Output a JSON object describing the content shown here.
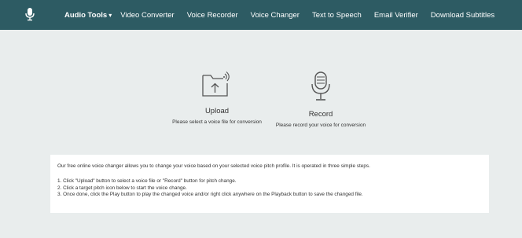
{
  "nav": {
    "logo_icon": "microphone-icon",
    "items": [
      "Audio Tools",
      "Video Converter",
      "Voice Recorder",
      "Voice Changer",
      "Text to Speech",
      "Email Verifier",
      "Download Subtitles"
    ],
    "dropdown_icon": "caret-down-icon"
  },
  "actions": {
    "upload": {
      "title": "Upload",
      "subtitle": "Please select a voice file for conversion",
      "icon": "upload-folder-icon"
    },
    "record": {
      "title": "Record",
      "subtitle": "Please record your voice for conversion",
      "icon": "microphone-icon"
    }
  },
  "info": {
    "intro": "Our free online voice changer allows you to change your voice based on your selected voice pitch profile. It is operated in three simple steps.",
    "steps": [
      "1. Click \"Upload\" button to select a voice file or \"Record\" button for pitch change.",
      "2. Click a target pitch icon below to start the voice change.",
      "3. Once done, click the Play button to play the changed voice and/or right click anywhere on the Playback button to save the changed file."
    ]
  },
  "colors": {
    "navbar": "#2d5b63",
    "background": "#e9eded",
    "panel": "#ffffff"
  }
}
